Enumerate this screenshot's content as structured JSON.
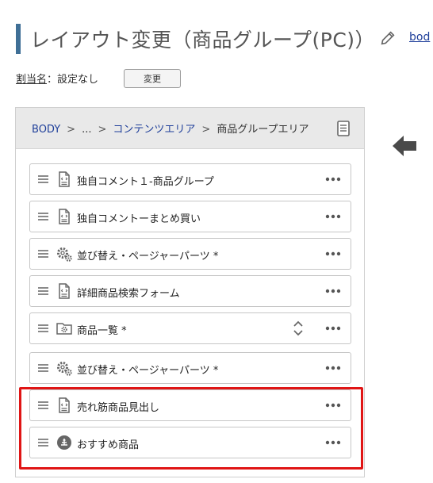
{
  "header": {
    "title": "レイアウト変更（商品グループ(PC)）",
    "body_link": "bod"
  },
  "assign": {
    "key": "割当名",
    "value": "：設定なし",
    "change_button": "変更"
  },
  "breadcrumb": {
    "items": [
      "BODY",
      "...",
      "コンテンツエリア",
      "商品グループエリア"
    ],
    "separator": ">"
  },
  "items": [
    {
      "label": "独自コメント１-商品グループ",
      "icon": "document-code-icon"
    },
    {
      "label": "独自コメントーまとめ買い",
      "icon": "document-code-icon"
    },
    {
      "label": "並び替え・ページャーパーツ *",
      "icon": "gears-icon"
    },
    {
      "label": "詳細商品検索フォーム",
      "icon": "document-code-icon"
    },
    {
      "label": "商品一覧 *",
      "icon": "folder-gear-icon",
      "has_expand": true
    },
    {
      "label": "並び替え・ページャーパーツ *",
      "icon": "gears-icon"
    },
    {
      "label": "売れ筋商品見出し",
      "icon": "document-code-icon"
    },
    {
      "label": "おすすめ商品",
      "icon": "recommend-circle-icon"
    }
  ],
  "colors": {
    "accent_bar": "#3f6f96",
    "link": "#1f3f9a",
    "highlight": "#e01515"
  }
}
